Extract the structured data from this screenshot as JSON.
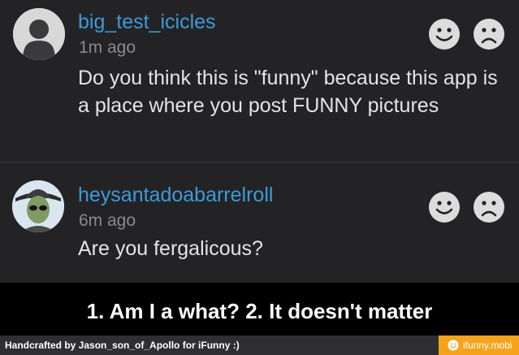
{
  "comments": [
    {
      "username": "big_test_icicles",
      "timestamp": "1m ago",
      "text": "Do you think this is \"funny\" because this app is a place where you post FUNNY pictures",
      "avatar": "default-user-icon"
    },
    {
      "username": "heysantadoabarrelroll",
      "timestamp": "6m ago",
      "text": "Are you fergalicous?",
      "avatar": "alien-photo-avatar"
    }
  ],
  "reactions": {
    "like_icon": "smiley-face-icon",
    "dislike_icon": "frowning-face-icon"
  },
  "caption": "1. Am I a what? 2. It doesn't matter",
  "footer": {
    "credit": "Handcrafted by Jason_son_of_Apollo for iFunny :)",
    "brand": "ifunny.mobi",
    "brand_icon": "smiley-icon"
  },
  "colors": {
    "background": "#232326",
    "username": "#3d9ad6",
    "timestamp": "#8a8a8e",
    "text": "#e4e4e4",
    "brand": "#f6a31c"
  }
}
